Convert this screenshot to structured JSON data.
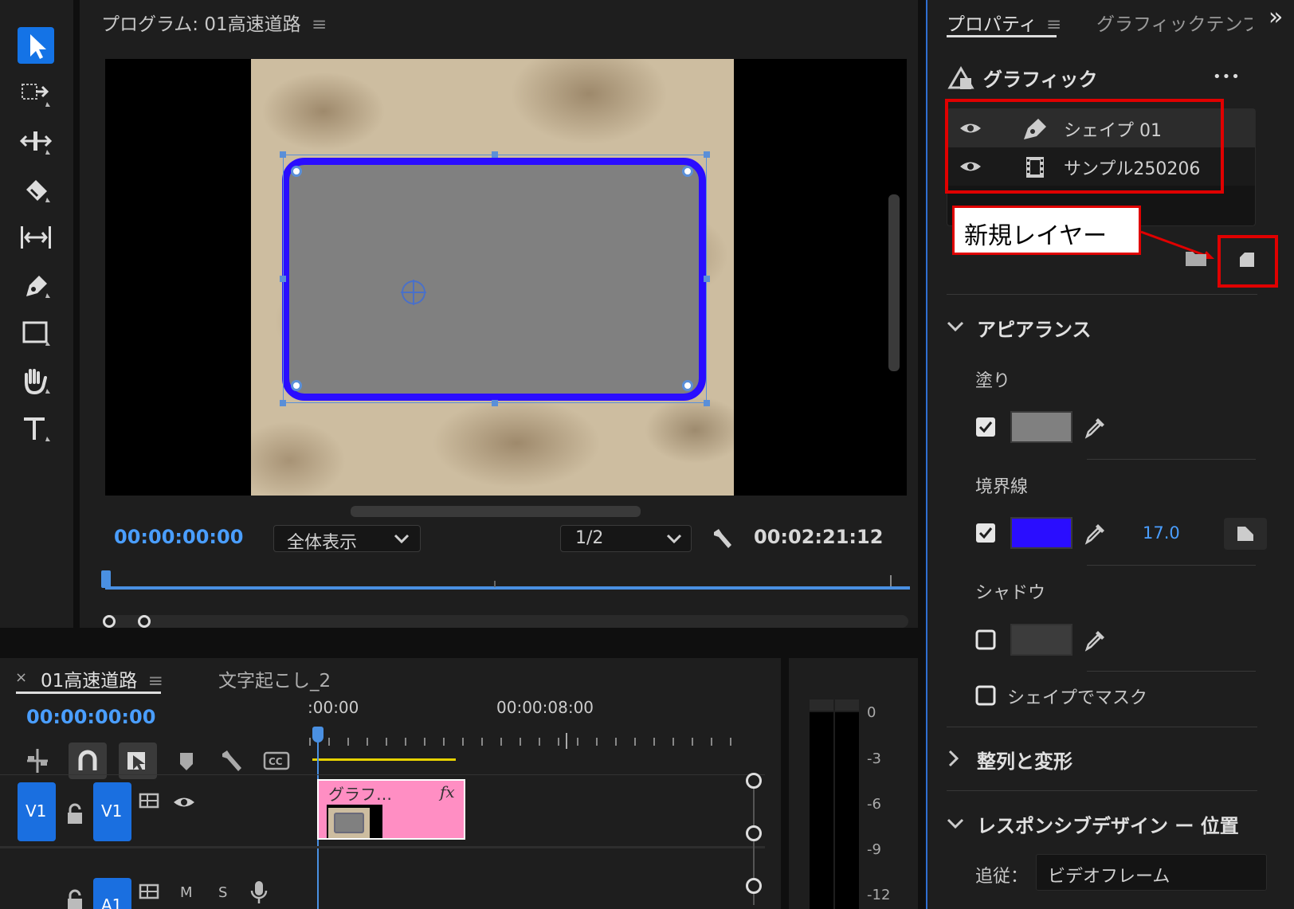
{
  "monitor": {
    "title": "プログラム: 01高速道路",
    "menu_glyph": "≡",
    "timecode_current": "00:00:00:00",
    "zoom_select": "全体表示",
    "resolution_select": "1/2",
    "timecode_duration": "00:02:21:12"
  },
  "properties": {
    "tab_active": "プロパティ",
    "tab_other": "グラフィックテンプ",
    "more_tabs_glyph": "»",
    "section_title": "グラフィック",
    "more_glyph": "•••",
    "layers": [
      {
        "name": "シェイプ 01"
      },
      {
        "name": "サンプル250206"
      }
    ],
    "callout_label": "新規レイヤー",
    "appearance": {
      "title": "アピアランス",
      "fill_label": "塗り",
      "stroke_label": "境界線",
      "stroke_value": "17.0",
      "shadow_label": "シャドウ",
      "mask_label": "シェイプでマスク"
    },
    "align_title": "整列と変形",
    "responsive": {
      "title": "レスポンシブデザイン ー 位置",
      "follow_label": "追従：",
      "follow_value": "ビデオフレーム"
    }
  },
  "timeline": {
    "close_glyph": "×",
    "tab_active": "01高速道路",
    "tab_other": "文字起こし_2",
    "timecode": "00:00:00:00",
    "ruler_start": ":00:00",
    "ruler_mark": "00:00:08:00",
    "clip_label": "グラフ…",
    "fx_label": "fx",
    "tracks": {
      "v1_source": "V1",
      "v1_target": "V1",
      "a1_target": "A1",
      "mute": "M",
      "solo": "S"
    }
  },
  "meter": {
    "scale": [
      "0",
      "-3",
      "-6",
      "-9",
      "-12"
    ]
  },
  "colors": {
    "accent_blue": "#4a90e2",
    "stroke_color": "#2a0dff",
    "fill_color": "#808080",
    "highlight_red": "#e00000",
    "clip_pink": "#ff8ec3"
  }
}
